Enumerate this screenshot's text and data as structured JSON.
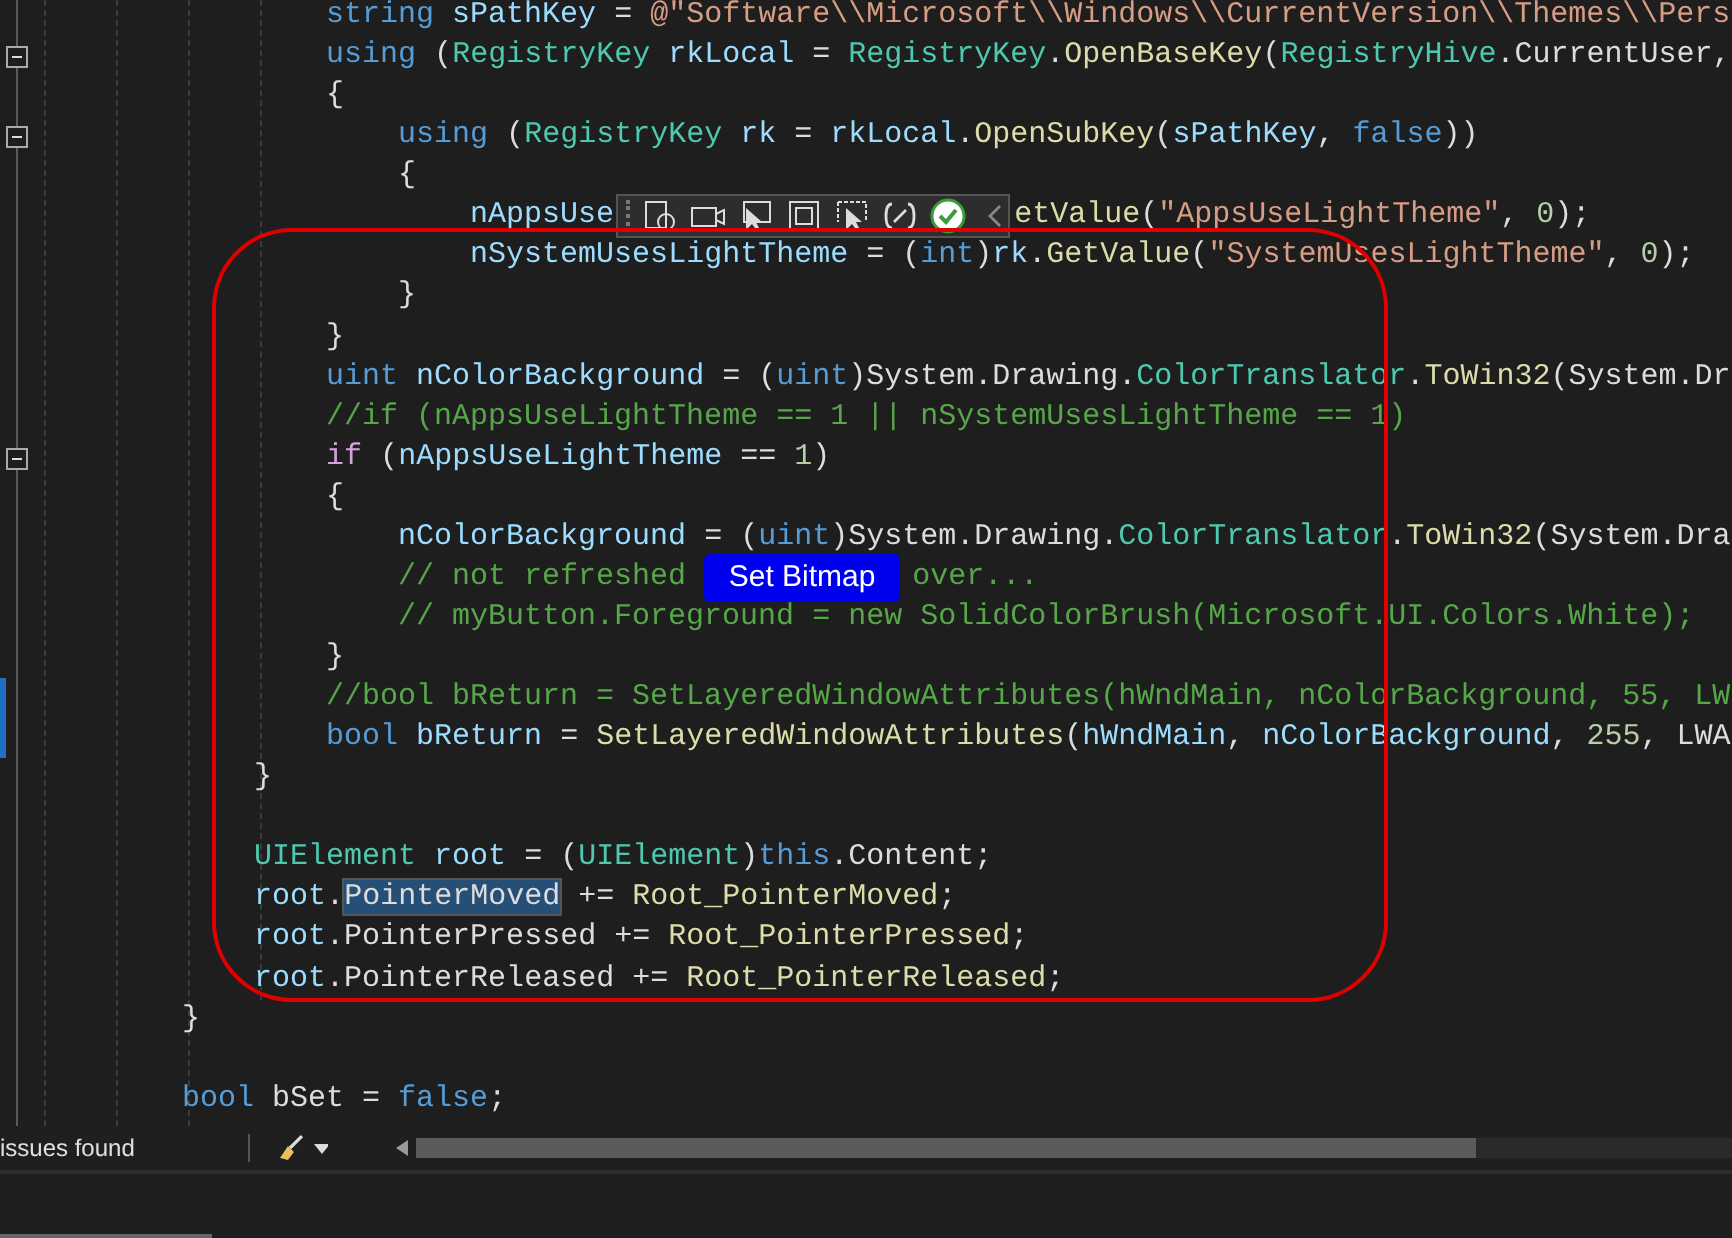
{
  "editor": {
    "lines": [
      {
        "kind": "code",
        "tokens": [
          {
            "kind": "kw",
            "text": "                string"
          },
          {
            "kind": "var",
            "text": " sPathKey"
          },
          {
            "kind": "txt",
            "text": " = "
          },
          {
            "kind": "str",
            "text": "@\"Software\\\\Microsoft\\\\Windows\\\\CurrentVersion\\\\Themes\\\\Pers"
          }
        ]
      },
      {
        "kind": "code",
        "fold": true,
        "tokens": [
          {
            "kind": "kw",
            "text": "                using"
          },
          {
            "kind": "txt",
            "text": " ("
          },
          {
            "kind": "type",
            "text": "RegistryKey"
          },
          {
            "kind": "var",
            "text": " rkLocal"
          },
          {
            "kind": "txt",
            "text": " = "
          },
          {
            "kind": "type",
            "text": "RegistryKey"
          },
          {
            "kind": "txt",
            "text": "."
          },
          {
            "kind": "fn",
            "text": "OpenBaseKey"
          },
          {
            "kind": "txt",
            "text": "("
          },
          {
            "kind": "type",
            "text": "RegistryHive"
          },
          {
            "kind": "txt",
            "text": ".CurrentUser,"
          }
        ]
      },
      {
        "kind": "code",
        "tokens": [
          {
            "kind": "txt",
            "text": "                {"
          }
        ]
      },
      {
        "kind": "code",
        "fold": true,
        "tokens": [
          {
            "kind": "kw",
            "text": "                    using"
          },
          {
            "kind": "txt",
            "text": " ("
          },
          {
            "kind": "type",
            "text": "RegistryKey"
          },
          {
            "kind": "var",
            "text": " rk"
          },
          {
            "kind": "txt",
            "text": " = "
          },
          {
            "kind": "var",
            "text": "rkLocal"
          },
          {
            "kind": "txt",
            "text": "."
          },
          {
            "kind": "fn",
            "text": "OpenSubKey"
          },
          {
            "kind": "txt",
            "text": "("
          },
          {
            "kind": "var",
            "text": "sPathKey"
          },
          {
            "kind": "txt",
            "text": ", "
          },
          {
            "kind": "kw",
            "text": "false"
          },
          {
            "kind": "txt",
            "text": "))"
          }
        ]
      },
      {
        "kind": "code",
        "tokens": [
          {
            "kind": "txt",
            "text": "                    {"
          }
        ]
      },
      {
        "kind": "code",
        "tokens": [
          {
            "kind": "var",
            "text": "                        nAppsUse"
          },
          {
            "kind": "toolbar"
          },
          {
            "kind": "fn",
            "text": "etValue"
          },
          {
            "kind": "txt",
            "text": "("
          },
          {
            "kind": "str",
            "text": "\"AppsUseLightTheme\""
          },
          {
            "kind": "txt",
            "text": ", "
          },
          {
            "kind": "num",
            "text": "0"
          },
          {
            "kind": "txt",
            "text": ");"
          }
        ]
      },
      {
        "kind": "code",
        "tokens": [
          {
            "kind": "var",
            "text": "                        nSystemUsesLightTheme"
          },
          {
            "kind": "txt",
            "text": " = ("
          },
          {
            "kind": "kw",
            "text": "int"
          },
          {
            "kind": "txt",
            "text": ")"
          },
          {
            "kind": "var",
            "text": "rk"
          },
          {
            "kind": "txt",
            "text": "."
          },
          {
            "kind": "fn",
            "text": "GetValue"
          },
          {
            "kind": "txt",
            "text": "("
          },
          {
            "kind": "str",
            "text": "\"SystemUsesLightTheme\""
          },
          {
            "kind": "txt",
            "text": ", "
          },
          {
            "kind": "num",
            "text": "0"
          },
          {
            "kind": "txt",
            "text": ");"
          }
        ]
      },
      {
        "kind": "code",
        "tokens": [
          {
            "kind": "txt",
            "text": "                    }"
          }
        ]
      },
      {
        "kind": "code",
        "tokens": [
          {
            "kind": "txt",
            "text": "                }"
          }
        ]
      },
      {
        "kind": "code",
        "tokens": [
          {
            "kind": "kw",
            "text": "                uint"
          },
          {
            "kind": "var",
            "text": " nColorBackground"
          },
          {
            "kind": "txt",
            "text": " = ("
          },
          {
            "kind": "kw",
            "text": "uint"
          },
          {
            "kind": "txt",
            "text": ")System.Drawing."
          },
          {
            "kind": "type",
            "text": "ColorTranslator"
          },
          {
            "kind": "txt",
            "text": "."
          },
          {
            "kind": "fn",
            "text": "ToWin32"
          },
          {
            "kind": "txt",
            "text": "(System.Dr"
          }
        ]
      },
      {
        "kind": "code",
        "tokens": [
          {
            "kind": "cmt",
            "text": "                //if (nAppsUseLightTheme == 1 || nSystemUsesLightTheme == 1)"
          }
        ]
      },
      {
        "kind": "code",
        "fold": true,
        "tokens": [
          {
            "kind": "ctl",
            "text": "                if"
          },
          {
            "kind": "txt",
            "text": " ("
          },
          {
            "kind": "var",
            "text": "nAppsUseLightTheme"
          },
          {
            "kind": "txt",
            "text": " == "
          },
          {
            "kind": "num",
            "text": "1"
          },
          {
            "kind": "txt",
            "text": ")"
          }
        ]
      },
      {
        "kind": "code",
        "tokens": [
          {
            "kind": "txt",
            "text": "                {"
          }
        ]
      },
      {
        "kind": "code",
        "tokens": [
          {
            "kind": "var",
            "text": "                    nColorBackground"
          },
          {
            "kind": "txt",
            "text": " = ("
          },
          {
            "kind": "kw",
            "text": "uint"
          },
          {
            "kind": "txt",
            "text": ")System.Drawing."
          },
          {
            "kind": "type",
            "text": "ColorTranslator"
          },
          {
            "kind": "txt",
            "text": "."
          },
          {
            "kind": "fn",
            "text": "ToWin32"
          },
          {
            "kind": "txt",
            "text": "(System.Dra"
          }
        ]
      },
      {
        "kind": "code",
        "tokens": [
          {
            "kind": "cmt",
            "text": "                    // not refreshed"
          },
          {
            "kind": "button",
            "text": "Set Bitmap"
          },
          {
            "kind": "cmt",
            "text": "over..."
          }
        ]
      },
      {
        "kind": "code",
        "tokens": [
          {
            "kind": "cmt",
            "text": "                    // myButton.Foreground = new SolidColorBrush(Microsoft.UI.Colors.White);"
          }
        ]
      },
      {
        "kind": "code",
        "tokens": [
          {
            "kind": "txt",
            "text": "                }"
          }
        ]
      },
      {
        "kind": "code",
        "changed": true,
        "tokens": [
          {
            "kind": "cmt",
            "text": "                //bool bReturn = SetLayeredWindowAttributes(hWndMain, nColorBackground, 55, LW"
          }
        ]
      },
      {
        "kind": "code",
        "changed": true,
        "tokens": [
          {
            "kind": "kw",
            "text": "                bool"
          },
          {
            "kind": "var",
            "text": " bReturn"
          },
          {
            "kind": "txt",
            "text": " = "
          },
          {
            "kind": "fn",
            "text": "SetLayeredWindowAttributes"
          },
          {
            "kind": "txt",
            "text": "("
          },
          {
            "kind": "var",
            "text": "hWndMain"
          },
          {
            "kind": "txt",
            "text": ", "
          },
          {
            "kind": "var",
            "text": "nColorBackground"
          },
          {
            "kind": "txt",
            "text": ", "
          },
          {
            "kind": "num",
            "text": "255"
          },
          {
            "kind": "txt",
            "text": ", LWA"
          }
        ]
      },
      {
        "kind": "code",
        "tokens": [
          {
            "kind": "txt",
            "text": "            }"
          }
        ]
      },
      {
        "kind": "blank"
      },
      {
        "kind": "code",
        "tokens": [
          {
            "kind": "type",
            "text": "            UIElement"
          },
          {
            "kind": "var",
            "text": " root"
          },
          {
            "kind": "txt",
            "text": " = ("
          },
          {
            "kind": "type",
            "text": "UIElement"
          },
          {
            "kind": "txt",
            "text": ")"
          },
          {
            "kind": "kw",
            "text": "this"
          },
          {
            "kind": "txt",
            "text": ".Content;"
          }
        ]
      },
      {
        "kind": "code",
        "tokens": [
          {
            "kind": "var",
            "text": "            root"
          },
          {
            "kind": "txt",
            "text": "."
          },
          {
            "kind": "hl",
            "text": "PointerMoved"
          },
          {
            "kind": "txt",
            "text": " += "
          },
          {
            "kind": "fn",
            "text": "Root_PointerMoved"
          },
          {
            "kind": "txt",
            "text": ";"
          }
        ]
      },
      {
        "kind": "code",
        "tokens": [
          {
            "kind": "var",
            "text": "            root"
          },
          {
            "kind": "txt",
            "text": ".PointerPressed += "
          },
          {
            "kind": "fn",
            "text": "Root_PointerPressed"
          },
          {
            "kind": "txt",
            "text": ";"
          }
        ]
      },
      {
        "kind": "code",
        "tokens": [
          {
            "kind": "var",
            "text": "            root"
          },
          {
            "kind": "txt",
            "text": ".PointerReleased += "
          },
          {
            "kind": "fn",
            "text": "Root_PointerReleased"
          },
          {
            "kind": "txt",
            "text": ";"
          }
        ]
      },
      {
        "kind": "code",
        "tokens": [
          {
            "kind": "txt",
            "text": "        }"
          }
        ]
      },
      {
        "kind": "blank"
      },
      {
        "kind": "code",
        "tokens": [
          {
            "kind": "kw",
            "text": "        bool"
          },
          {
            "kind": "txt",
            "text": " bSet = "
          },
          {
            "kind": "kw",
            "text": "false"
          },
          {
            "kind": "txt",
            "text": ";"
          }
        ]
      }
    ]
  },
  "status_bar": {
    "issues": "issues found"
  }
}
